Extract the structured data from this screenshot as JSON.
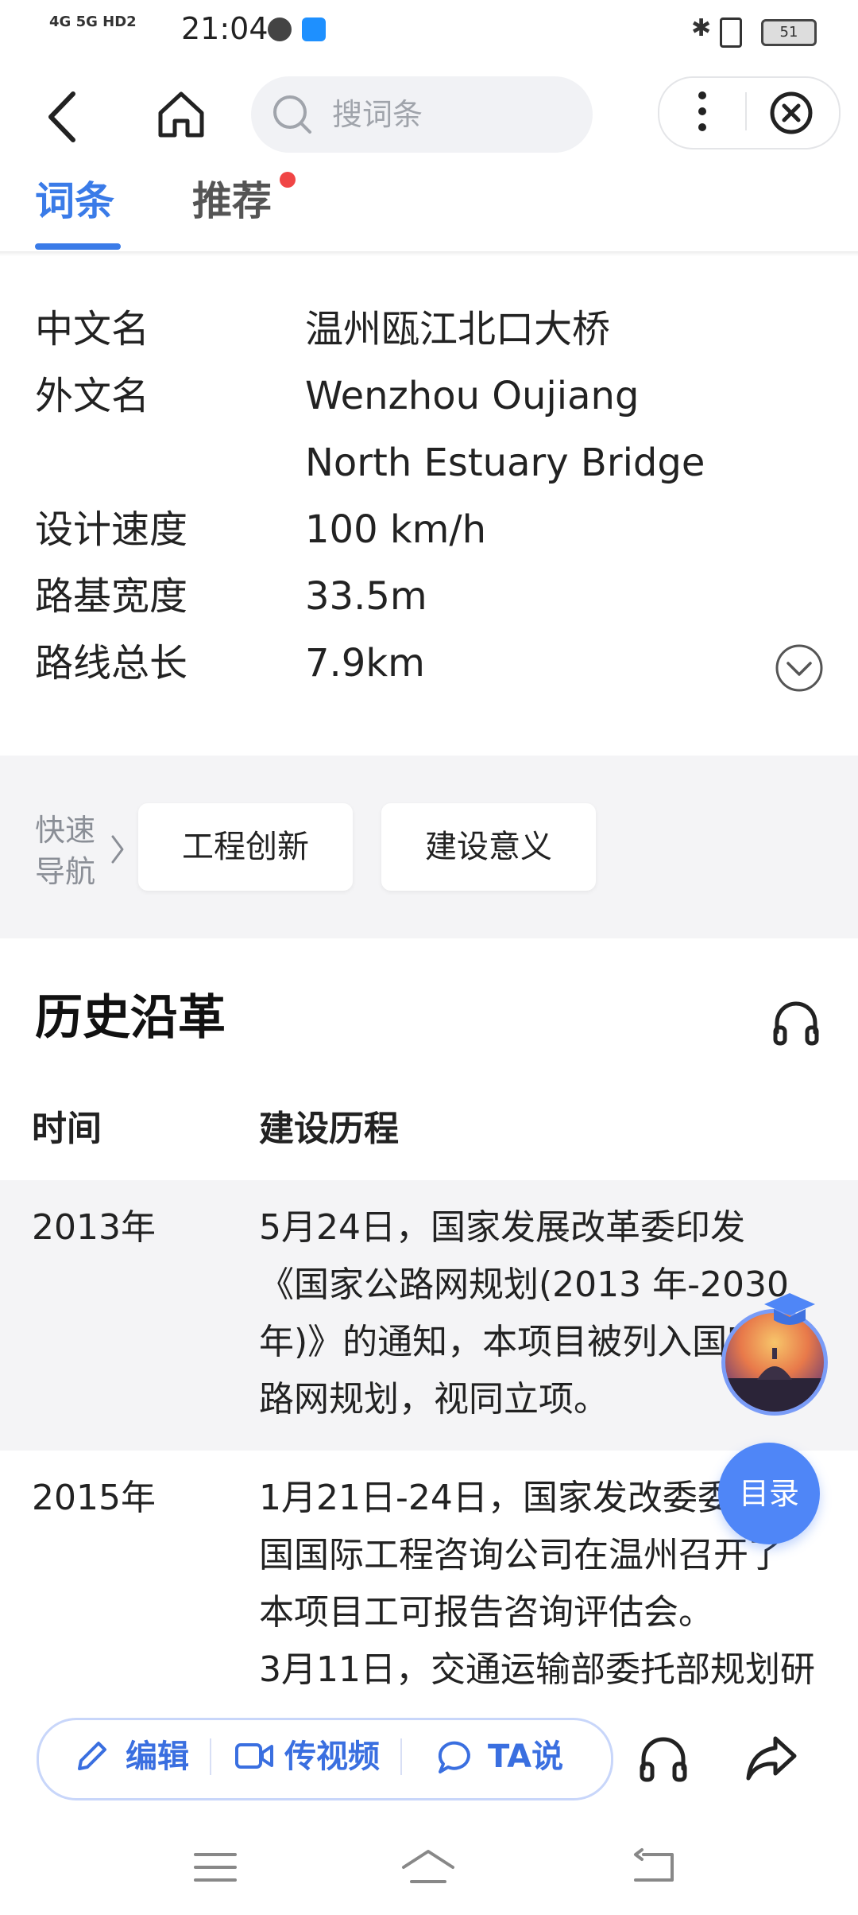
{
  "status_bar": {
    "network": "4G 5G HD2",
    "time": "21:04",
    "battery": "51"
  },
  "header": {
    "search_placeholder": "搜词条"
  },
  "tabs": [
    {
      "label": "词条",
      "active": true
    },
    {
      "label": "推荐",
      "active": false,
      "has_badge": true
    }
  ],
  "infobox": [
    {
      "label": "中文名",
      "value": "温州瓯江北口大桥"
    },
    {
      "label": "外文名",
      "value": "Wenzhou Oujiang",
      "value2": "North Estuary Bridge"
    },
    {
      "label": "设计速度",
      "value": "100 km/h"
    },
    {
      "label": "路基宽度",
      "value": "33.5m"
    },
    {
      "label": "路线总长",
      "value": "7.9km"
    }
  ],
  "quick_nav": {
    "label_line1": "快速",
    "label_line2": "导航",
    "items": [
      "工程创新",
      "建设意义"
    ]
  },
  "section": {
    "title": "历史沿革",
    "columns": [
      "时间",
      "建设历程"
    ],
    "rows": [
      {
        "year": "2013年",
        "lines": [
          "5月24日，国家发展改革委印发",
          "《国家公路网规划(2013 年-2030",
          "年)》的通知，本项目被列入国家公",
          "路网规划，视同立项。"
        ]
      },
      {
        "year": "2015年",
        "lines": [
          "1月21日-24日，国家发改委委托中",
          "国国际工程咨询公司在温州召开了",
          "本项目工可报告咨询评估会。",
          "3月11日，交通运输部委托部规划研"
        ]
      }
    ]
  },
  "floating": {
    "menu_label": "目录"
  },
  "bottom_actions": {
    "edit": "编辑",
    "video": "传视频",
    "ta": "TA说"
  },
  "colors": {
    "accent": "#3a7be8",
    "action_blue": "#3a6fe0",
    "badge_red": "#f04545",
    "gray_bg": "#f4f4f6"
  }
}
